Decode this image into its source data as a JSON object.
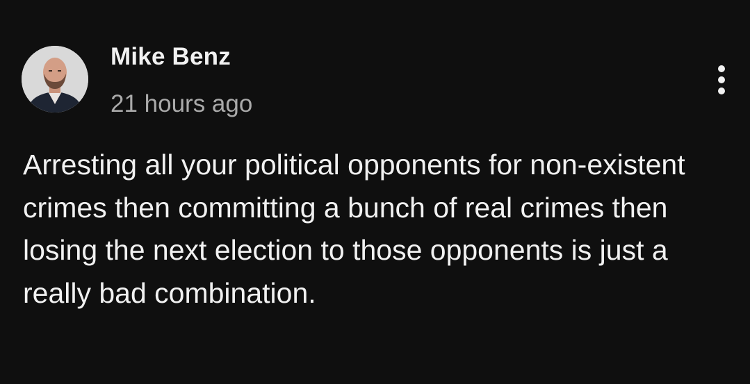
{
  "post": {
    "author": "Mike Benz",
    "timestamp": "21 hours ago",
    "body": "Arresting all your political opponents for non-existent crimes then committing a bunch of real crimes then losing the next election to those opponents is just a really bad combination.",
    "menu_icon": "more-vertical-icon"
  },
  "colors": {
    "background": "#0f0f0f",
    "text_primary": "#f1f1f1",
    "text_secondary": "#aaaaaa"
  }
}
